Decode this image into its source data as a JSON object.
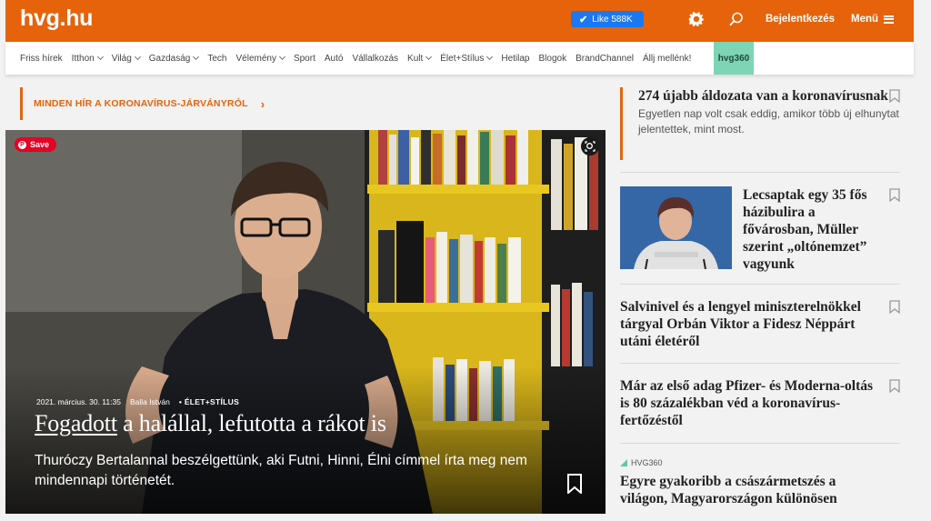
{
  "header": {
    "logo": "hvg.hu",
    "like_label": "Like 588K",
    "login_label": "Bejelentkezés",
    "menu_label": "Menü",
    "brand_color": "#e6630b"
  },
  "nav": {
    "items": [
      {
        "label": "Friss hírek",
        "dropdown": false
      },
      {
        "label": "Itthon",
        "dropdown": true
      },
      {
        "label": "Világ",
        "dropdown": true
      },
      {
        "label": "Gazdaság",
        "dropdown": true
      },
      {
        "label": "Tech",
        "dropdown": false
      },
      {
        "label": "Vélemény",
        "dropdown": true
      },
      {
        "label": "Sport",
        "dropdown": false
      },
      {
        "label": "Autó",
        "dropdown": false
      },
      {
        "label": "Vállalkozás",
        "dropdown": false
      },
      {
        "label": "Kult",
        "dropdown": true
      },
      {
        "label": "Élet+Stílus",
        "dropdown": true
      },
      {
        "label": "Hetilap",
        "dropdown": false
      },
      {
        "label": "Blogok",
        "dropdown": false
      },
      {
        "label": "BrandChannel",
        "dropdown": false
      },
      {
        "label": "Állj mellénk!",
        "dropdown": false
      }
    ],
    "hvg360_label": "hvg360"
  },
  "banner": {
    "text": "MINDEN HÍR A KORONAVÍRUS-JÁRVÁNYRÓL"
  },
  "hero": {
    "save_label": "Save",
    "date": "2021. március. 30. 11:35",
    "author": "Balla István",
    "category": "ÉLET+STÍLUS",
    "title_underlined": "Fogadott",
    "title_rest": " a halállal, lefutotta a rákot is",
    "lead": "Thuróczy Bertalannal beszélgettünk, aki Futni, Hinni, Élni címmel írta meg nem mindennapi történetét."
  },
  "sidebar": {
    "items": [
      {
        "title": "274 újabb áldozata van a koronavírusnak",
        "lead": "Egyetlen nap volt csak eddig, amikor több új elhunytat jelentettek, mint most."
      },
      {
        "title": "Lecsaptak egy 35 fős házibulira a fővárosban, Müller szerint „oltónemzet” vagyunk"
      },
      {
        "title": "Salvinivel és a lengyel miniszterelnökkel tárgyal Orbán Viktor a Fidesz Néppárt utáni életéről"
      },
      {
        "title": "Már az első adag Pfizer- és Moderna-oltás is 80 százalékban véd a koronavírus-fertőzéstől"
      },
      {
        "tag": "HVG360",
        "title": "Egyre gyakoribb a császármetszés a világon, Magyarországon különösen"
      }
    ]
  }
}
